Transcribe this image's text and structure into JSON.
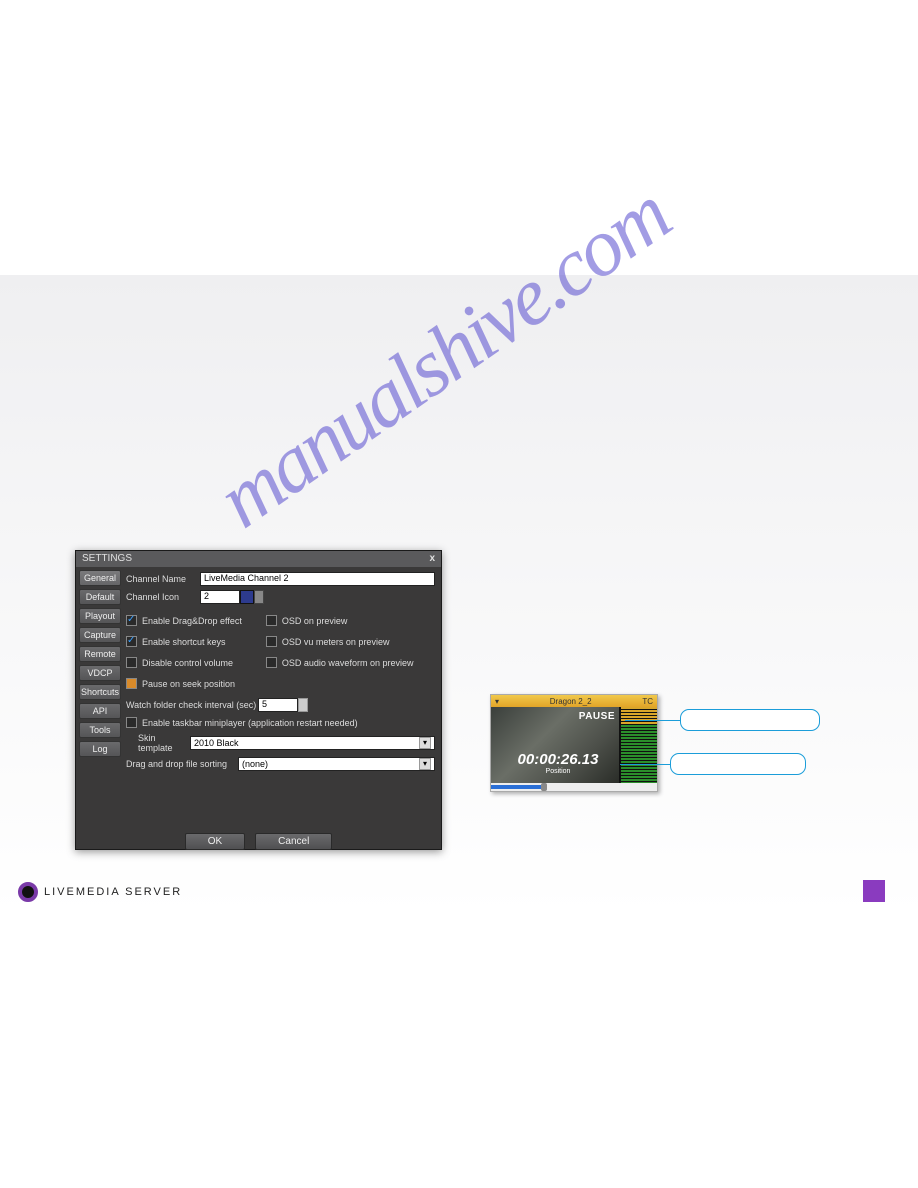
{
  "watermark": "manualshive.com",
  "dialog": {
    "title": "SETTINGS",
    "close": "x",
    "tabs": [
      "General",
      "Default",
      "Playout",
      "Capture",
      "Remote",
      "VDCP",
      "Shortcuts",
      "API",
      "Tools",
      "Log"
    ],
    "fields": {
      "channel_name_label": "Channel Name",
      "channel_name_value": "LiveMedia Channel 2",
      "channel_icon_label": "Channel Icon",
      "channel_icon_value": "2",
      "enable_dragdrop": "Enable Drag&Drop effect",
      "enable_shortcut": "Enable shortcut keys",
      "disable_volume": "Disable control volume",
      "pause_seek": "Pause on seek position",
      "osd_preview": "OSD on preview",
      "osd_vu": "OSD vu meters on preview",
      "osd_wave": "OSD audio waveform on preview",
      "watch_label": "Watch folder check interval (sec)",
      "watch_value": "5",
      "taskbar_mini": "Enable taskbar miniplayer (application restart needed)",
      "skin_label": "Skin template",
      "skin_value": "2010 Black",
      "sort_label": "Drag and drop file sorting",
      "sort_value": "(none)"
    },
    "buttons": {
      "ok": "OK",
      "cancel": "Cancel"
    }
  },
  "preview": {
    "title": "Dragon 2_2",
    "tc_label": "TC",
    "state": "PAUSE",
    "timecode": "00:00:26.13",
    "pos_label": "Position"
  },
  "footer": {
    "brand": "LIVEMEDIA SERVER"
  }
}
